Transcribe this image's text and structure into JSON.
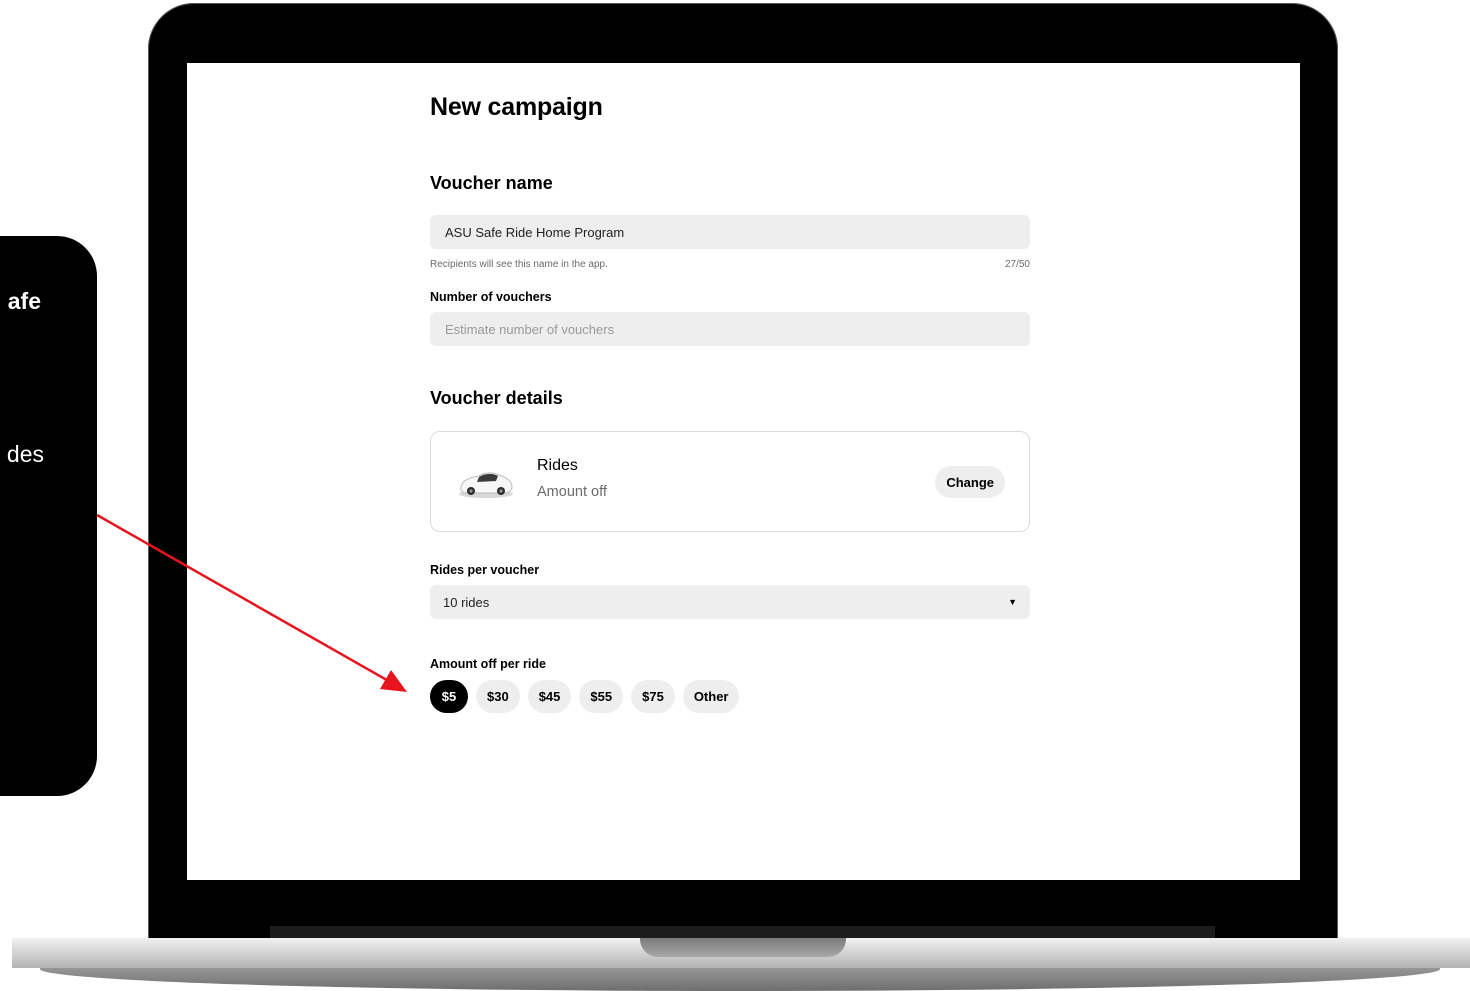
{
  "callout": {
    "line1_fragment": "afe",
    "line2_fragment": "des"
  },
  "page": {
    "title": "New campaign"
  },
  "voucher_name": {
    "heading": "Voucher name",
    "value": "ASU Safe Ride Home Program",
    "helper": "Recipients will see this name in the app.",
    "counter": "27/50"
  },
  "number_of_vouchers": {
    "label": "Number of vouchers",
    "placeholder": "Estimate number of vouchers"
  },
  "voucher_details": {
    "heading": "Voucher details",
    "card_title": "Rides",
    "card_subtitle": "Amount off",
    "change_label": "Change"
  },
  "rides_per_voucher": {
    "label": "Rides per voucher",
    "value": "10 rides",
    "caret": "▼"
  },
  "amount_off": {
    "label": "Amount off per ride",
    "options": [
      "$5",
      "$30",
      "$45",
      "$55",
      "$75",
      "Other"
    ],
    "selected": "$5"
  },
  "colors": {
    "annotation_arrow": "#e8141e",
    "selected_chip": "#000000",
    "field_bg": "#eeeeee"
  }
}
